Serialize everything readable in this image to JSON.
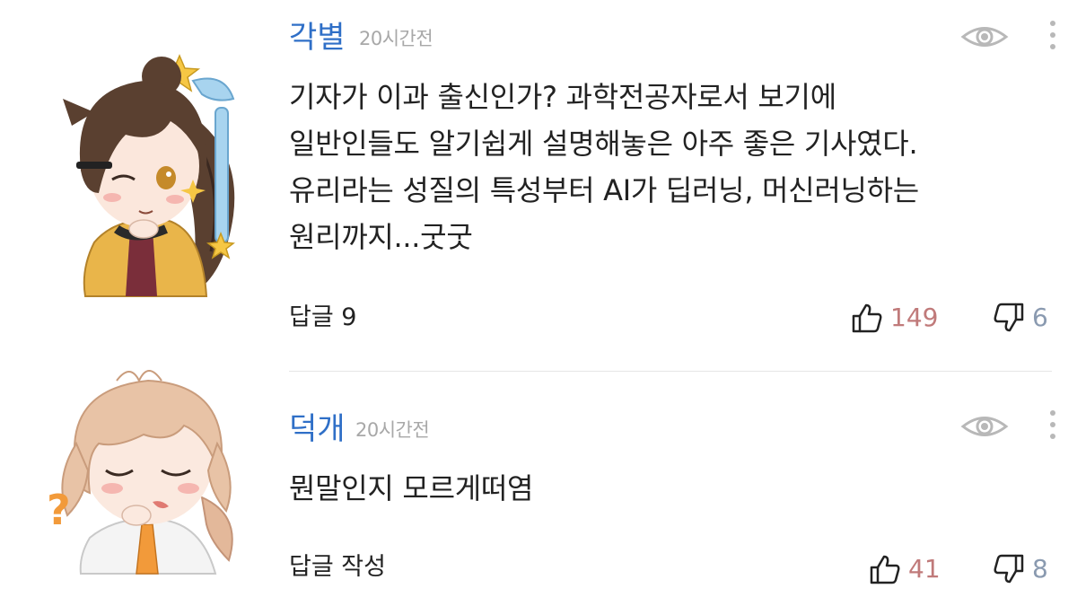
{
  "comments": [
    {
      "author": "각별",
      "time": "20시간전",
      "lines": [
        "기자가 이과 출신인가? 과학전공자로서 보기에",
        "일반인들도 알기쉽게 설명해놓은 아주 좋은 기사였다.",
        "유리라는 성질의 특성부터 AI가 딥러닝, 머신러닝하는",
        "원리까지...굿굿"
      ],
      "reply_label": "답글 9",
      "likes": "149",
      "dislikes": "6"
    },
    {
      "author": "덕개",
      "time": "20시간전",
      "lines": [
        "뭔말인지 모르게떠염"
      ],
      "reply_label": "답글 작성",
      "likes": "41",
      "dislikes": "8"
    }
  ],
  "colors": {
    "author": "#2f6fc7",
    "time": "#a8a8a8",
    "like_count": "#c07a7a",
    "dislike_count": "#8a9ab0"
  },
  "icons": [
    "eye-icon",
    "more-vertical-icon",
    "thumbs-up-icon",
    "thumbs-down-icon"
  ]
}
